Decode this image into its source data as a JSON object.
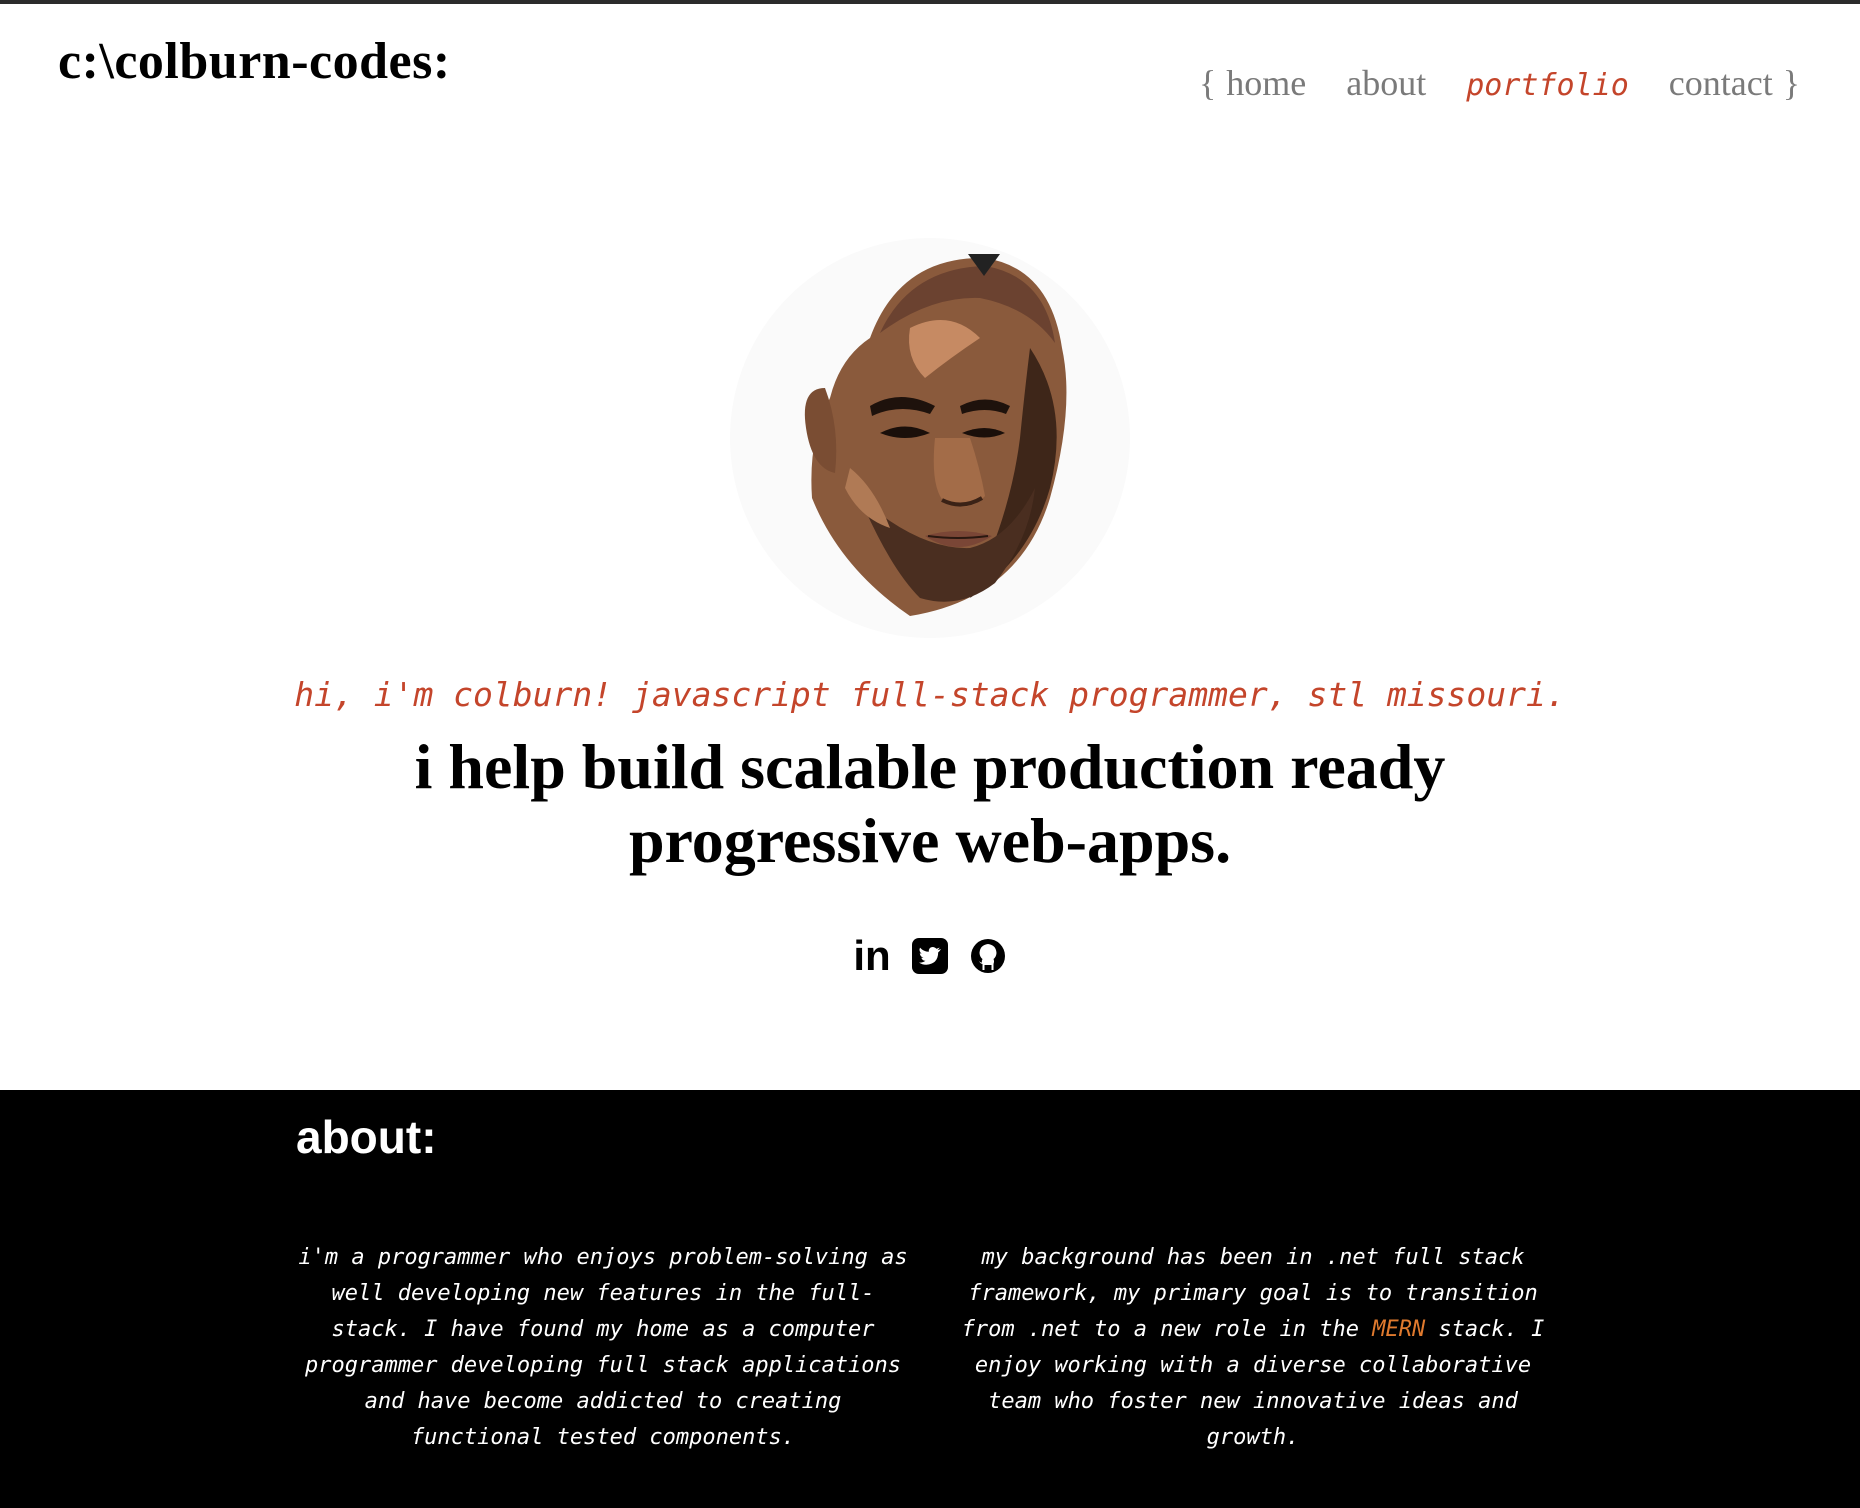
{
  "header": {
    "logo": "c:\\colburn-codes:",
    "nav": {
      "open_brace": "{",
      "close_brace": "}",
      "items": [
        {
          "label": "home"
        },
        {
          "label": "about"
        },
        {
          "label": "portfolio"
        },
        {
          "label": "contact"
        }
      ],
      "active": "portfolio"
    }
  },
  "hero": {
    "tagline": "hi, i'm colburn! javascript full-stack programmer, stl missouri.",
    "headline_line1": "i help build scalable production ready",
    "headline_line2": "progressive web-apps.",
    "socials": [
      {
        "icon": "linkedin-icon",
        "text": "in"
      },
      {
        "icon": "twitter-icon"
      },
      {
        "icon": "github-icon"
      }
    ]
  },
  "about": {
    "title": "about:",
    "left_text": "i'm a programmer who enjoys problem-solving as well developing new features in the full-stack. I have found my home as a computer programmer developing full stack applications and have become addicted to creating functional tested components.",
    "right_before": "my background has been in .net full stack framework, my primary goal is to transition from .net to a new role in the ",
    "right_highlight": "MERN",
    "right_after": " stack. I enjoy working with a diverse collaborative team who foster new innovative ideas and growth."
  },
  "colors": {
    "accent": "#c4452b",
    "nav_text": "#7a7a7a",
    "highlight": "#e07a2e",
    "about_bg": "#000000"
  }
}
